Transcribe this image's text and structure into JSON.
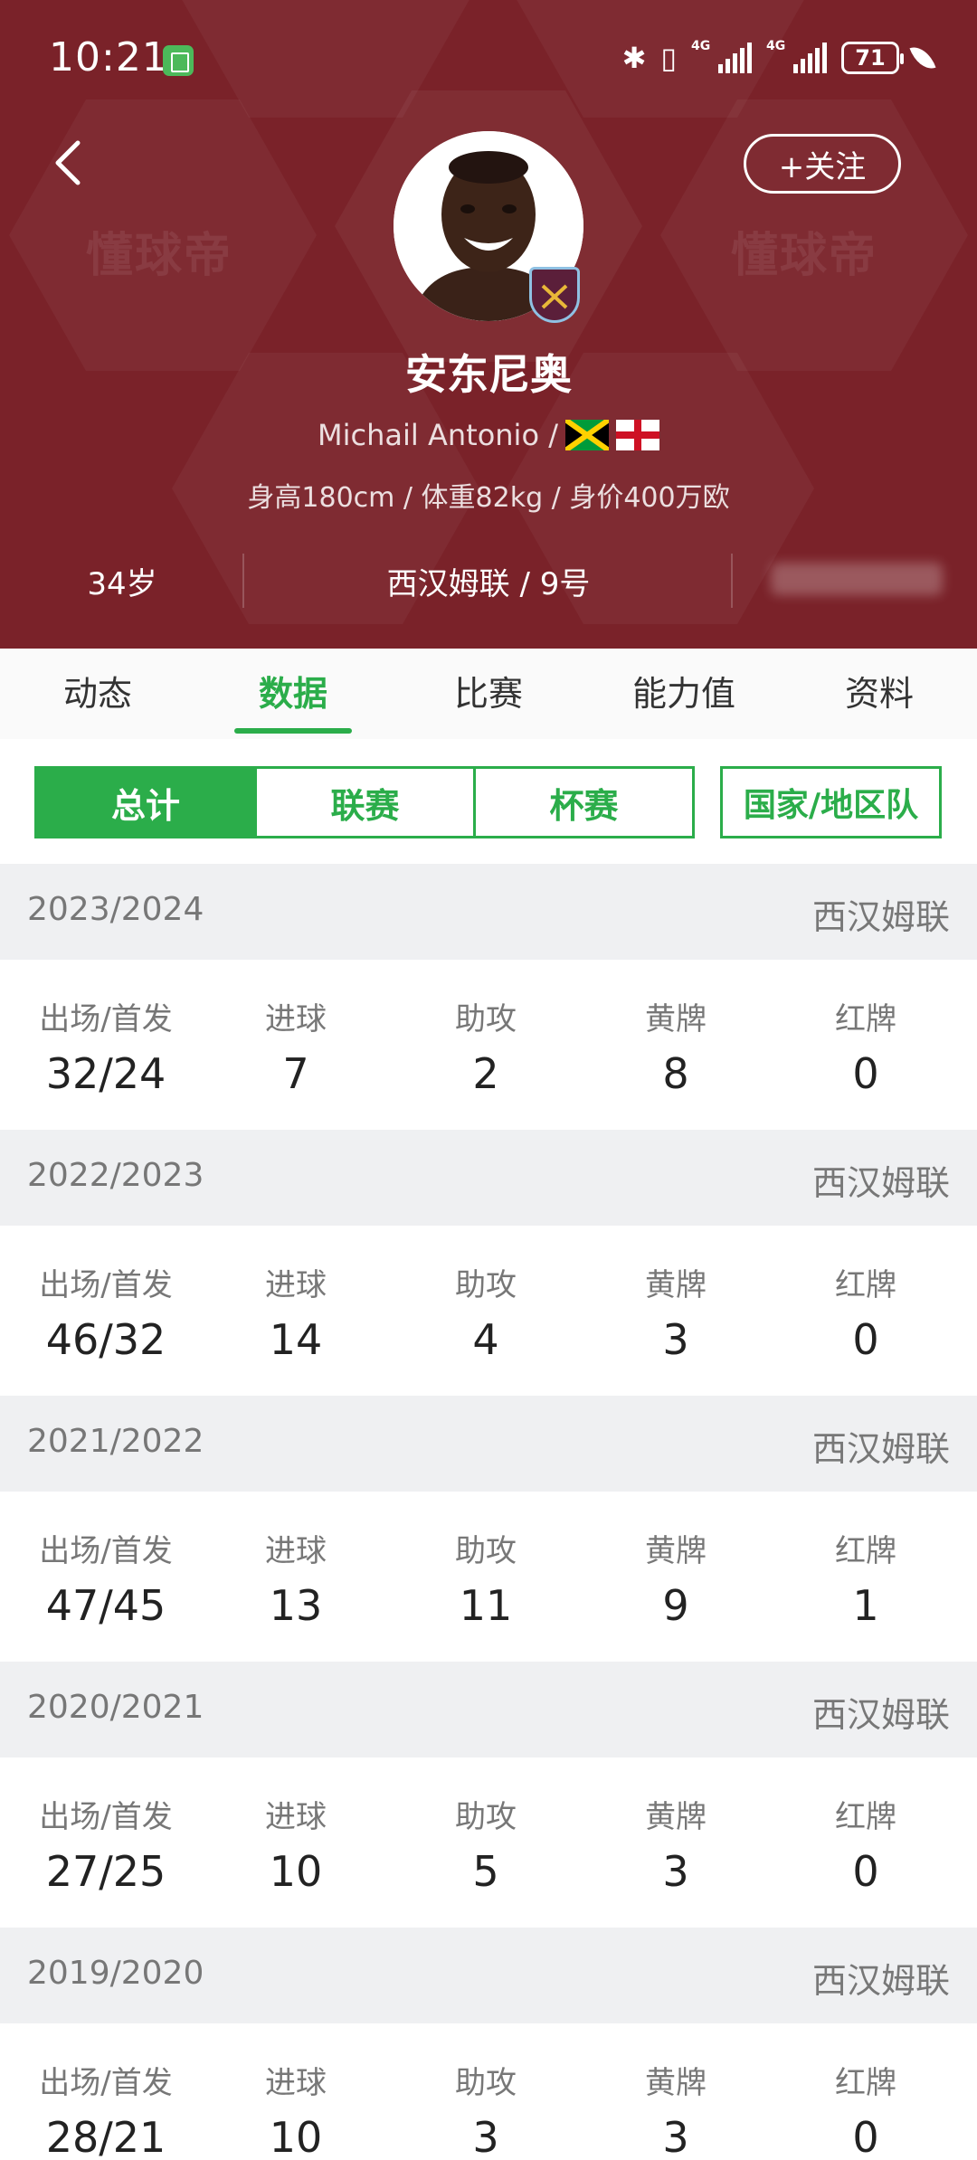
{
  "status_bar": {
    "time": "10:21",
    "network1": "4G",
    "network2": "4G",
    "battery": "71"
  },
  "header": {
    "watermark": "懂球帝",
    "follow_label": "+关注",
    "player_name": "安东尼奥",
    "english_name": "Michail Antonio /",
    "body_info": "身高180cm / 体重82kg / 身价400万欧",
    "age": "34岁",
    "club_number": "西汉姆联 / 9号"
  },
  "tabs": [
    "动态",
    "数据",
    "比赛",
    "能力值",
    "资料"
  ],
  "active_tab": "数据",
  "segments": [
    "总计",
    "联赛",
    "杯赛",
    "国家/地区队"
  ],
  "active_segment": "总计",
  "stat_labels": [
    "出场/首发",
    "进球",
    "助攻",
    "黄牌",
    "红牌"
  ],
  "seasons": [
    {
      "year": "2023/2024",
      "club": "西汉姆联",
      "values": [
        "32/24",
        "7",
        "2",
        "8",
        "0"
      ]
    },
    {
      "year": "2022/2023",
      "club": "西汉姆联",
      "values": [
        "46/32",
        "14",
        "4",
        "3",
        "0"
      ]
    },
    {
      "year": "2021/2022",
      "club": "西汉姆联",
      "values": [
        "47/45",
        "13",
        "11",
        "9",
        "1"
      ]
    },
    {
      "year": "2020/2021",
      "club": "西汉姆联",
      "values": [
        "27/25",
        "10",
        "5",
        "3",
        "0"
      ]
    },
    {
      "year": "2019/2020",
      "club": "西汉姆联",
      "values": [
        "28/21",
        "10",
        "3",
        "3",
        "0"
      ]
    }
  ],
  "colors": {
    "header_bg": "#7a2229",
    "accent": "#2bad4a"
  }
}
